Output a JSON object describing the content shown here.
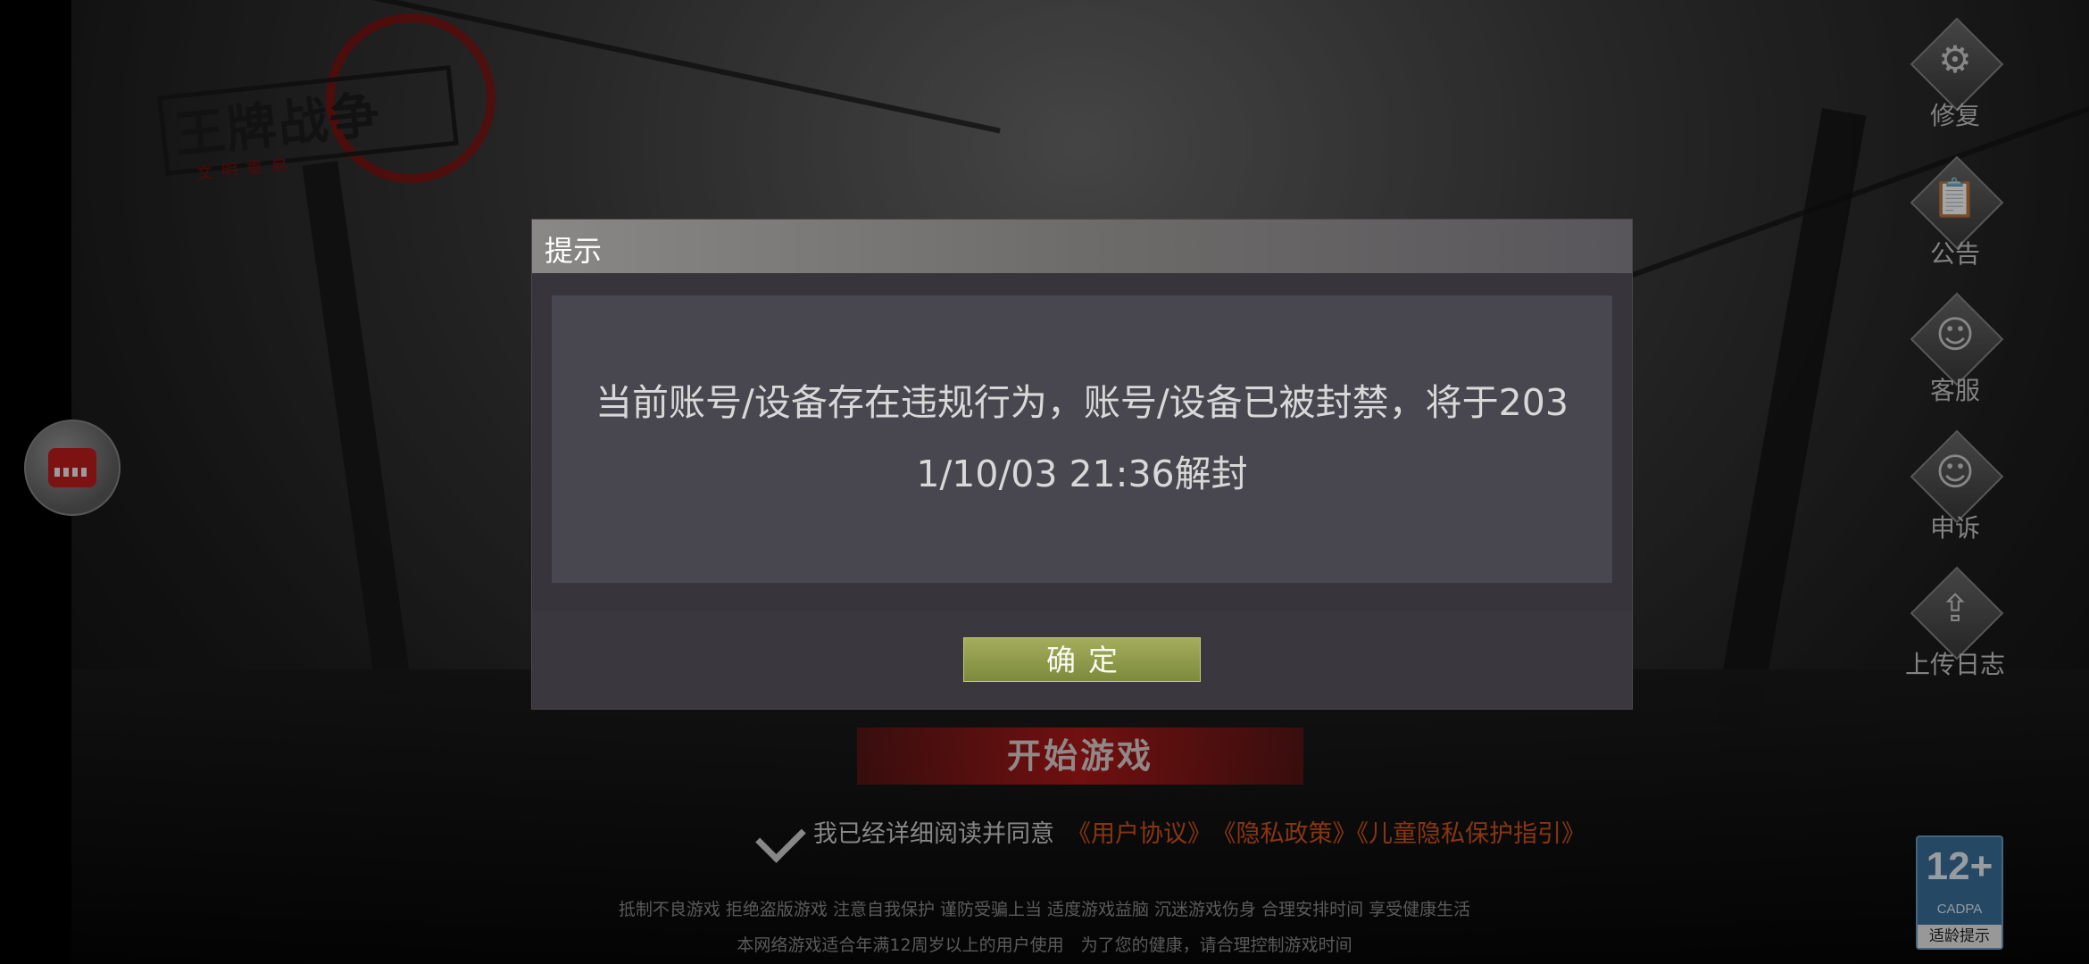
{
  "logo": {
    "title": "王牌战争",
    "subtitle": "文明重启"
  },
  "side_menu": [
    {
      "label": "修复",
      "icon": "gear-icon"
    },
    {
      "label": "公告",
      "icon": "announcement-icon"
    },
    {
      "label": "客服",
      "icon": "support-icon"
    },
    {
      "label": "申诉",
      "icon": "appeal-icon"
    },
    {
      "label": "上传日志",
      "icon": "upload-icon"
    }
  ],
  "start_button": {
    "label": "开始游戏"
  },
  "agreement": {
    "text": "我已经详细阅读并同意",
    "user_agreement": "《用户协议》",
    "privacy_policy": "《隐私政策》",
    "child_privacy": "《儿童隐私保护指引》"
  },
  "health_notice": {
    "line1": "抵制不良游戏 拒绝盗版游戏 注意自我保护 谨防受骗上当 适度游戏益脑 沉迷游戏伤身 合理安排时间 享受健康生活",
    "line2": "本网络游戏适合年满12周岁以上的用户使用　为了您的健康，请合理控制游戏时间"
  },
  "age_badge": {
    "rating": "12+",
    "org": "CADPA",
    "tip": "适龄提示"
  },
  "dialog": {
    "title": "提示",
    "message_line1": "当前账号/设备存在违规行为，账号/设备已被封禁，将于203",
    "message_line2": "1/10/03 21:36解封",
    "ok_label": "确定"
  }
}
